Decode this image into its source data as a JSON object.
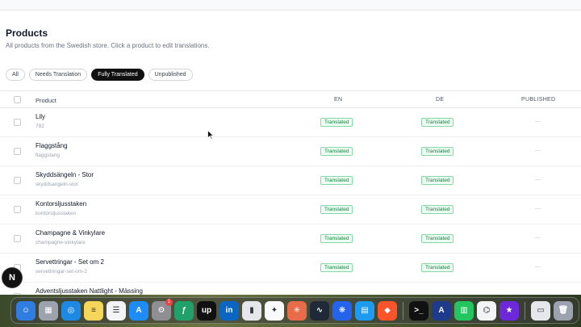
{
  "page": {
    "title": "Products",
    "subtitle": "All products from the Swedish store. Click a product to edit translations."
  },
  "filters": [
    "All",
    "Needs Translation",
    "Fully Translated",
    "Unpublished"
  ],
  "active_filter": "Fully Translated",
  "table": {
    "headers": {
      "product": "Product",
      "en": "EN",
      "de": "DE",
      "published": "PUBLISHED"
    },
    "rows": [
      {
        "name": "Lily",
        "slug": "782",
        "en": "Translated",
        "de": "Translated",
        "published": "—"
      },
      {
        "name": "Flaggstång",
        "slug": "flaggstang",
        "en": "Translated",
        "de": "Translated",
        "published": "—"
      },
      {
        "name": "Skyddsängeln - Stor",
        "slug": "skyddsangeln-stor",
        "en": "Translated",
        "de": "Translated",
        "published": "—"
      },
      {
        "name": "Kontorsljusstaken",
        "slug": "kontorsljusstaken",
        "en": "Translated",
        "de": "Translated",
        "published": "—"
      },
      {
        "name": "Champagne & Vinkylare",
        "slug": "champagne-vinkylare",
        "en": "Translated",
        "de": "Translated",
        "published": "—"
      },
      {
        "name": "Servettringar - Set om 2",
        "slug": "servettringar-set-om-2",
        "en": "Translated",
        "de": "Translated",
        "published": "—"
      },
      {
        "name": "Adventsljusstaken Nattlight - Mässing",
        "slug": "",
        "en": "",
        "de": "",
        "published": ""
      }
    ]
  },
  "overlay": {
    "n_label": "N"
  },
  "colors": {
    "accent": "#111111",
    "translated_bg": "#ecfdf3",
    "translated_text": "#15803d"
  },
  "dock": {
    "apps": [
      {
        "icon": "finder-icon",
        "color": "#2f7de1",
        "glyph": "☺"
      },
      {
        "icon": "launchpad-icon",
        "color": "#9ca3af",
        "glyph": "▦"
      },
      {
        "icon": "safari-icon",
        "color": "#1e88e5",
        "glyph": "◎"
      },
      {
        "icon": "notes-icon",
        "color": "#f6d65a",
        "glyph": "≡"
      },
      {
        "icon": "reminders-icon",
        "color": "#f3f4f6",
        "glyph": "☰"
      },
      {
        "icon": "app-store-icon",
        "color": "#1d8cf8",
        "glyph": "A"
      },
      {
        "icon": "system-settings-icon",
        "color": "#8e8e93",
        "glyph": "⚙",
        "badge": "1"
      },
      {
        "icon": "money-app-icon",
        "color": "#22a06b",
        "glyph": "ƒ"
      },
      {
        "icon": "upwork-icon",
        "color": "#111111",
        "glyph": "up"
      },
      {
        "icon": "linkedin-icon",
        "color": "#0a66c2",
        "glyph": "in"
      },
      {
        "icon": "books-icon",
        "color": "#e5e7eb",
        "glyph": "▮"
      },
      {
        "icon": "gemini-icon",
        "color": "#f8fafc",
        "glyph": "✦"
      },
      {
        "icon": "claude-icon",
        "color": "#e86b4a",
        "glyph": "✳"
      },
      {
        "icon": "activity-monitor-icon",
        "color": "#1f2937",
        "glyph": "∿"
      },
      {
        "icon": "flower-app-icon",
        "color": "#2563eb",
        "glyph": "❋"
      },
      {
        "icon": "docker-icon",
        "color": "#1d9bf0",
        "glyph": "▤"
      },
      {
        "icon": "brave-icon",
        "color": "#fb542b",
        "glyph": "◆"
      }
    ],
    "apps_right": [
      {
        "icon": "terminal-icon",
        "color": "#111111",
        "glyph": ">_"
      },
      {
        "icon": "vectorworks-icon",
        "color": "#1e3a8a",
        "glyph": "A"
      },
      {
        "icon": "numbers-icon",
        "color": "#22c55e",
        "glyph": "▥"
      },
      {
        "icon": "chatgpt-icon",
        "color": "#f3f4f6",
        "glyph": "⌬"
      },
      {
        "icon": "imovie-icon",
        "color": "#6d28d9",
        "glyph": "★"
      }
    ],
    "trailing": [
      {
        "icon": "document-preview-icon",
        "color": "#e5e7eb",
        "glyph": "▭"
      },
      {
        "icon": "trash-icon",
        "color": "#9ca3af",
        "glyph": "🗑"
      }
    ]
  }
}
